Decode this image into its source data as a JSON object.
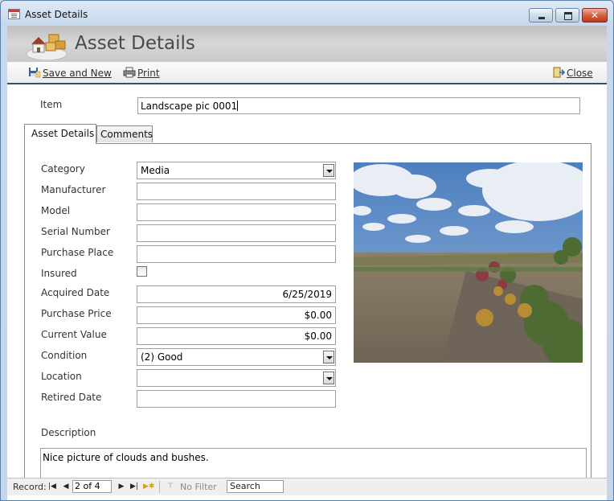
{
  "window": {
    "title": "Asset Details"
  },
  "header": {
    "title": "Asset Details"
  },
  "toolbar": {
    "save_new_label": "Save and New",
    "print_label": "Print",
    "close_label": "Close"
  },
  "item": {
    "label": "Item",
    "value": "Landscape pic 0001"
  },
  "tabs": [
    {
      "label": "Asset Details",
      "active": true
    },
    {
      "label": "Comments",
      "active": false
    }
  ],
  "fields": {
    "category": {
      "label": "Category",
      "value": "Media"
    },
    "manufacturer": {
      "label": "Manufacturer",
      "value": ""
    },
    "model": {
      "label": "Model",
      "value": ""
    },
    "serial_number": {
      "label": "Serial Number",
      "value": ""
    },
    "purchase_place": {
      "label": "Purchase Place",
      "value": ""
    },
    "insured": {
      "label": "Insured",
      "checked": false
    },
    "acquired_date": {
      "label": "Acquired Date",
      "value": "6/25/2019"
    },
    "purchase_price": {
      "label": "Purchase Price",
      "value": "$0.00"
    },
    "current_value": {
      "label": "Current Value",
      "value": "$0.00"
    },
    "condition": {
      "label": "Condition",
      "value": "(2) Good"
    },
    "location": {
      "label": "Location",
      "value": ""
    },
    "retired_date": {
      "label": "Retired Date",
      "value": ""
    }
  },
  "description": {
    "label": "Description",
    "value": "Nice picture of clouds and bushes."
  },
  "navigation": {
    "record_label": "Record:",
    "record_value": "2 of 4",
    "no_filter_label": "No Filter",
    "search_label": "Search"
  },
  "icons": {
    "title": "form-icon",
    "logo": "boxes-house-icon",
    "save": "save-new-icon",
    "print": "printer-icon",
    "close": "close-form-icon"
  },
  "colors": {
    "header_gray": "#c9c9c9",
    "toolbar_rule": "#35506f",
    "window_frame": "#c5d6ea",
    "close_button": "#c03a1c"
  }
}
